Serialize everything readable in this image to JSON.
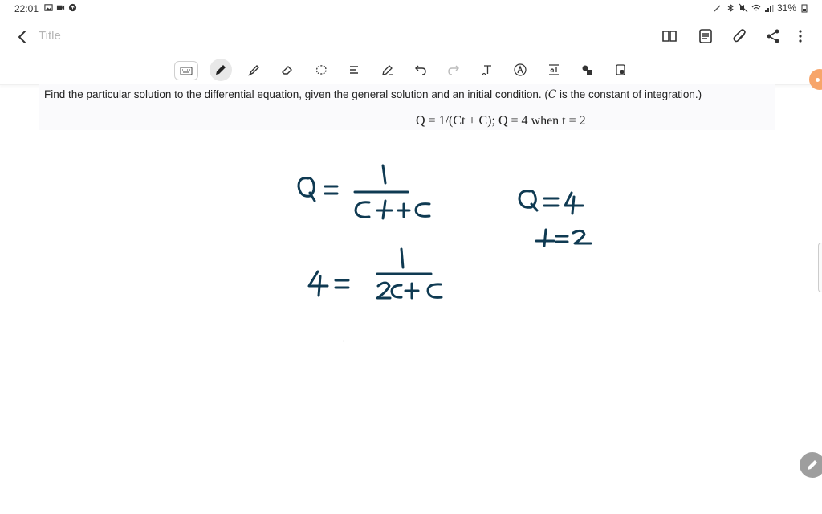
{
  "status": {
    "time": "22:01",
    "battery": "31%",
    "left_icons": [
      "image-icon",
      "video-icon",
      "sync-icon"
    ],
    "right_icons": [
      "pen-icon",
      "bluetooth-icon",
      "mute-icon",
      "wifi-icon",
      "signal-icon",
      "battery-icon"
    ]
  },
  "appbar": {
    "title_placeholder": "Title",
    "icons": [
      "book-icon",
      "document-icon",
      "attach-icon",
      "share-icon",
      "more-icon"
    ]
  },
  "toolbar": {
    "tools": [
      "keyboard-icon",
      "pen-icon",
      "highlighter-icon",
      "eraser-icon",
      "lasso-icon",
      "text-format-icon",
      "shape-pen-icon",
      "undo-icon",
      "redo-icon",
      "text-tool-icon",
      "font-icon",
      "spacing-icon",
      "shapes-icon",
      "lock-icon"
    ],
    "active_tool": "pen-icon"
  },
  "question": {
    "text_before": "Find the particular solution to the differential equation, given the general solution and an initial condition. (",
    "text_var": "C",
    "text_after": " is the constant of integration.)",
    "equation": "Q = 1/(Ct + C); Q = 4 when t = 2"
  },
  "colors": {
    "ink": "#0f3a52",
    "accent": "#f7a56a",
    "toolbar_active": "#e8e8e8"
  }
}
